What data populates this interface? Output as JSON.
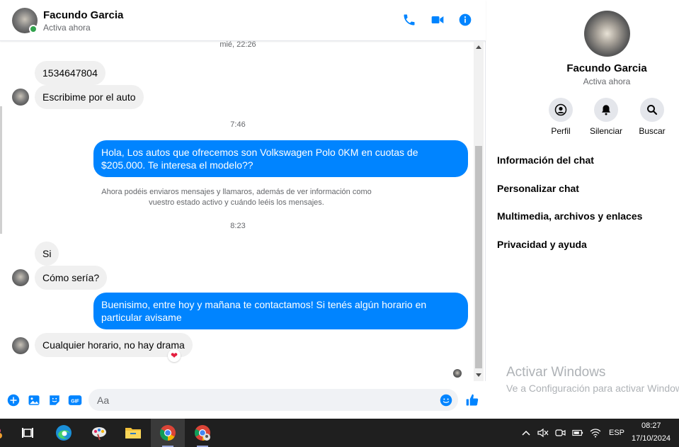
{
  "header": {
    "name": "Facundo Garcia",
    "status": "Activa ahora"
  },
  "messages": {
    "ts1": "mié, 22:26",
    "m1": "1534647804",
    "m2": "Escribime por el auto",
    "ts2": "7:46",
    "m3": "Hola, Los autos que ofrecemos son Volkswagen Polo 0KM en cuotas de $205.000. Te interesa el modelo??",
    "note": "Ahora podéis enviaros mensajes y llamaros, además de ver información como vuestro estado activo y cuándo leéis los mensajes.",
    "ts3": "8:23",
    "m4": "Si",
    "m5": "Cómo sería?",
    "m6": "Buenisimo, entre hoy y mañana te contactamos! Si tenés algún horario en particular avisame",
    "m7": "Cualquier horario, no hay drama",
    "reaction": "❤"
  },
  "composer": {
    "placeholder": "Aa",
    "gif_label": "GIF"
  },
  "info": {
    "name": "Facundo Garcia",
    "status": "Activa ahora",
    "actions": [
      "Perfil",
      "Silenciar",
      "Buscar"
    ],
    "menu": [
      "Información del chat",
      "Personalizar chat",
      "Multimedia, archivos y enlaces",
      "Privacidad y ayuda"
    ],
    "windows_activate_title": "Activar Windows",
    "windows_activate_sub": "Ve a Configuración para activar Windows."
  },
  "taskbar": {
    "language": "ESP",
    "time": "08:27",
    "date": "17/10/2024"
  },
  "colors": {
    "messenger_blue": "#0084ff",
    "online_green": "#31a24c"
  }
}
